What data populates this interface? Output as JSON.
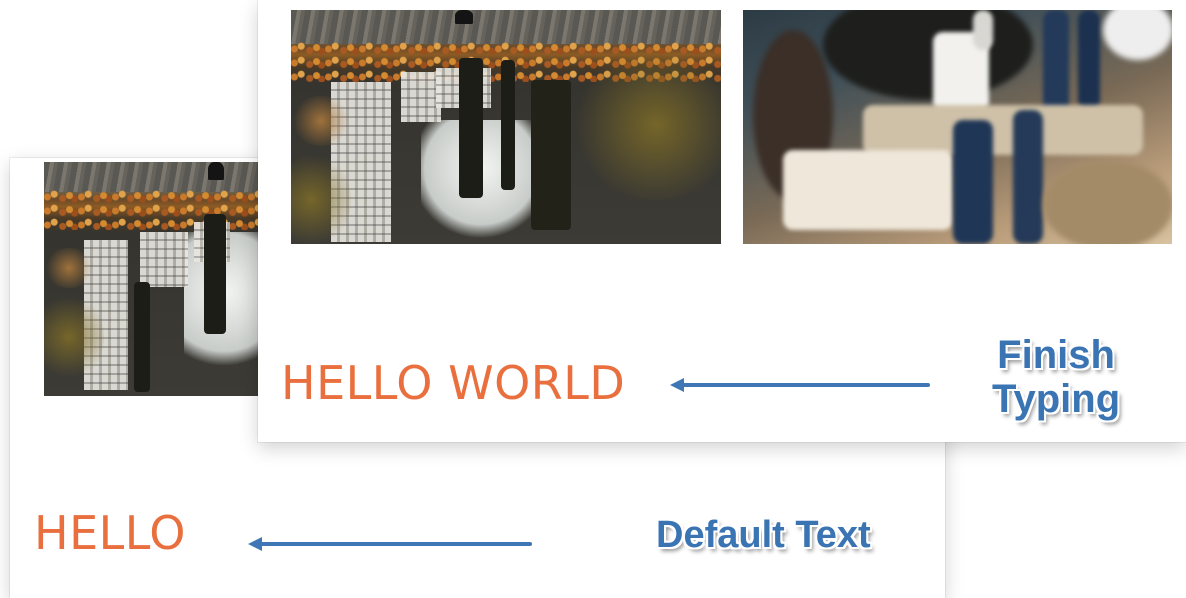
{
  "default_view": {
    "text": "HELLO",
    "callout": "Default Text"
  },
  "finished_view": {
    "text": "HELLO WORLD",
    "callout_line1": "Finish",
    "callout_line2": "Typing"
  },
  "colors": {
    "display_text": "#e9703e",
    "callout": "#3a74b3",
    "arrow": "#3f76b5"
  },
  "icons": {
    "arrow": "left-arrow-icon"
  }
}
